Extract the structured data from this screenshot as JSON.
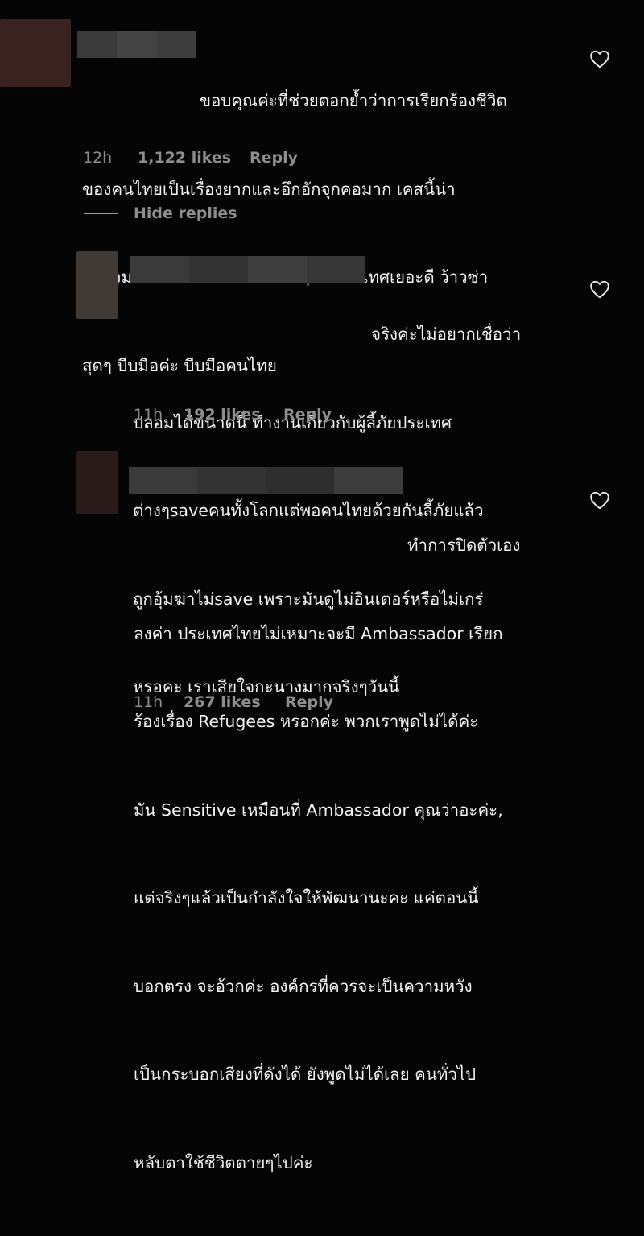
{
  "comments": [
    {
      "lines": [
        "ขอบคุณค่ะที่ช่วยตอกย้ำว่าการเรียกร้องชีวิต",
        "ของคนไทยเป็นเรื่องยากและอึกอักจุกคอมาก เคสนี้น่า",
        "สนใจมากค่ะ เราได้เห็นอะไรอึ้งๆ ในประเทศเยอะดี ว้าวซ่า",
        "สุดๆ บีบมือค่ะ บีบมือคนไทย"
      ],
      "time": "12h",
      "likes": "1,122 likes",
      "reply": "Reply"
    },
    {
      "lines": [
        "จริงค่ะไม่อยากเชื่อว่า",
        "ปลอมได้ขนาดนี้ ทำงานเกี่ยวกับผู้ลี้ภัยประเทศ",
        "ต่างๆsaveคนทั้งโลกแต่พอคนไทยด้วยกันลี้ภัยแล้ว",
        "ถูกอุ้มฆ่าไม่save เพราะมันดูไม่อินเตอร์หรือไม่เกร๋",
        "หรอคะ เราเสียใจกะนางมากจริงๆวันนี้"
      ],
      "time": "11h",
      "likes": "192 likes",
      "reply": "Reply"
    },
    {
      "lines": [
        "ทำการปิดตัวเอง",
        "ลงค่า ประเทศไทยไม่เหมาะจะมี Ambassador เรียก",
        "ร้องเรื่อง Refugees หรอกค่ะ พวกเราพูดไม่ได้ค่ะ",
        "มัน Sensitive เหมือนที่ Ambassador คุณว่าอะค่ะ,",
        "แต่จริงๆแล้วเป็นกำลังใจให้พัฒนานะคะ แค่ตอนนี้",
        "บอกตรง จะอ้วกค่ะ องค์กรที่ควรจะเป็นความหวัง",
        "เป็นกระบอกเสียงที่ดังได้ ยังพูดไม่ได้เลย คนทั่วไป",
        "หลับตาใช้ชีวิตตายๆไปค่ะ"
      ],
      "time": "11h",
      "likes": "267 likes",
      "reply": "Reply"
    }
  ],
  "hide_replies_label": "Hide replies",
  "colors": {
    "background": "#050505",
    "text": "#f4f4f4",
    "meta": "#8e8e8e",
    "avatar1": "#3a2220",
    "avatar2": "#3f3a36",
    "avatar3": "#2a1a1a"
  },
  "icons": {
    "like": "heart-outline-icon"
  }
}
